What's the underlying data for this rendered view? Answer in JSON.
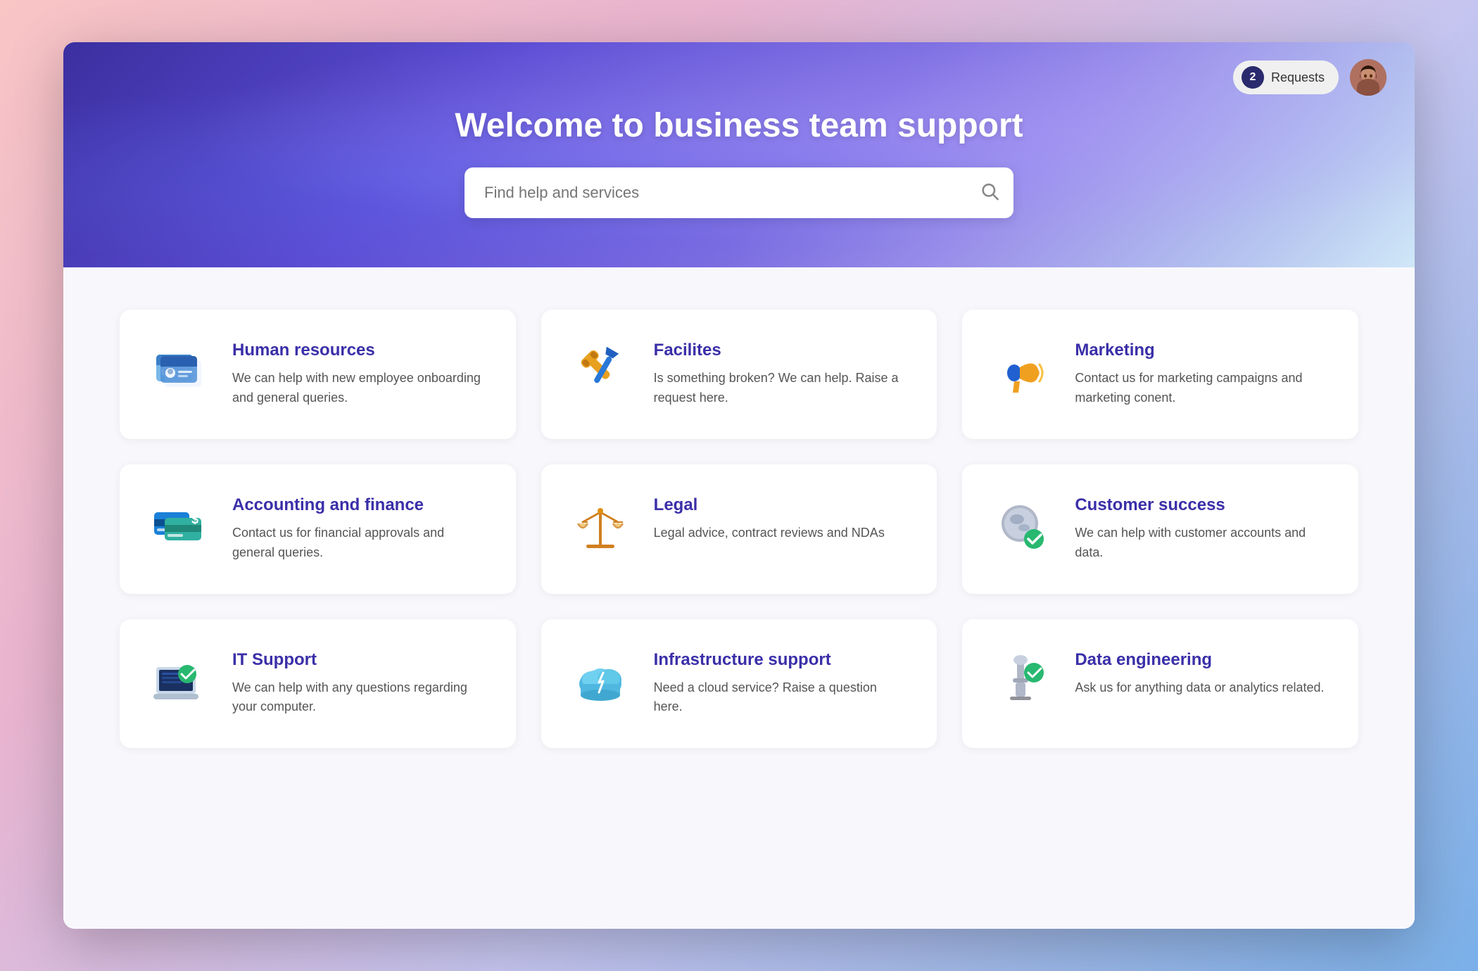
{
  "header": {
    "title": "Welcome to business team support",
    "search_placeholder": "Find help and services",
    "requests_count": "2",
    "requests_label": "Requests"
  },
  "cards": [
    {
      "id": "hr",
      "title": "Human resources",
      "description": "We can help with new employee onboarding and general queries."
    },
    {
      "id": "facilities",
      "title": "Facilites",
      "description": "Is something broken? We can help. Raise a request here."
    },
    {
      "id": "marketing",
      "title": "Marketing",
      "description": "Contact us for marketing campaigns and marketing conent."
    },
    {
      "id": "accounting",
      "title": "Accounting and finance",
      "description": "Contact us for financial approvals and general queries."
    },
    {
      "id": "legal",
      "title": "Legal",
      "description": "Legal advice, contract reviews and NDAs"
    },
    {
      "id": "customer-success",
      "title": "Customer success",
      "description": "We can help with customer accounts and data."
    },
    {
      "id": "it-support",
      "title": "IT Support",
      "description": "We can help with any questions regarding your computer."
    },
    {
      "id": "infrastructure",
      "title": "Infrastructure support",
      "description": "Need a cloud service? Raise a question here."
    },
    {
      "id": "data-engineering",
      "title": "Data engineering",
      "description": "Ask us for anything data or analytics related."
    }
  ]
}
